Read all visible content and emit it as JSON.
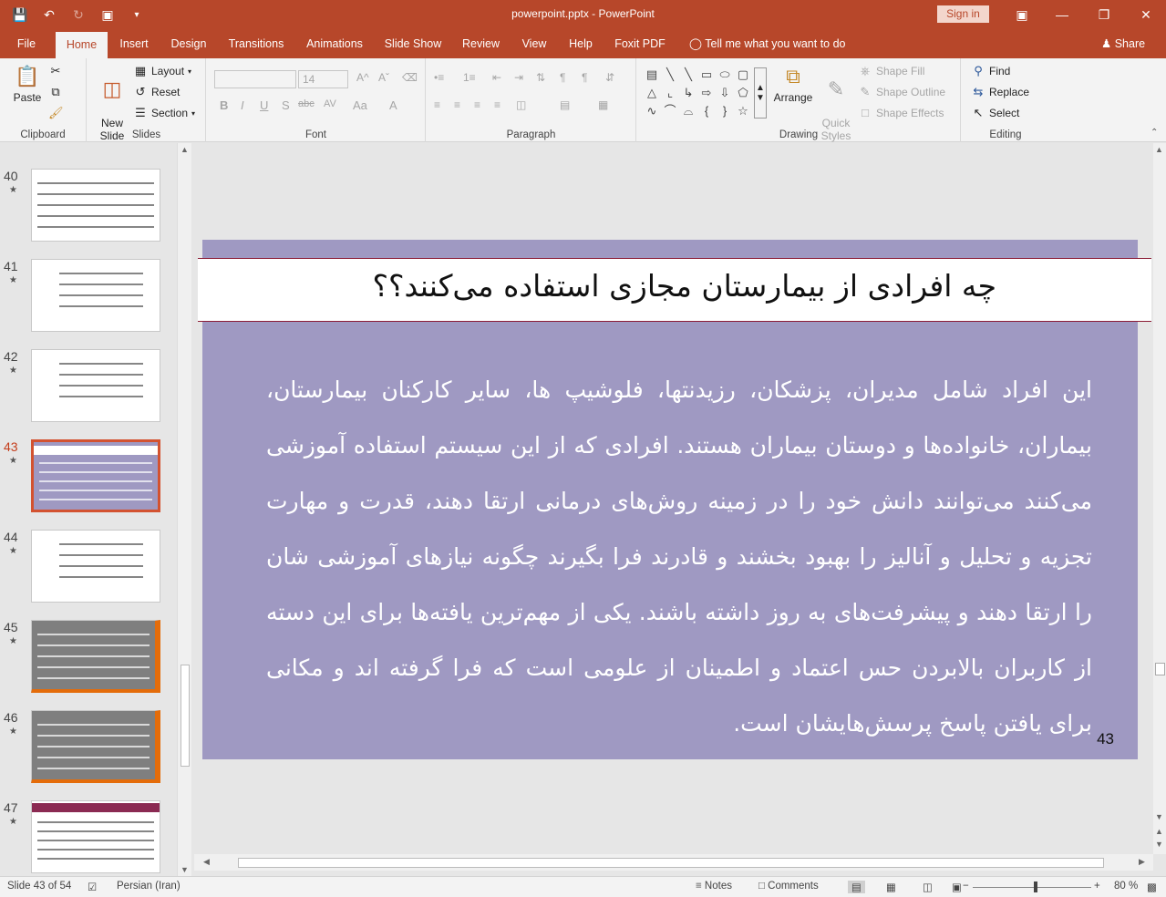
{
  "window": {
    "title": "powerpoint.pptx  -  PowerPoint",
    "signin": "Sign in"
  },
  "tabs": [
    "File",
    "Home",
    "Insert",
    "Design",
    "Transitions",
    "Animations",
    "Slide Show",
    "Review",
    "View",
    "Help",
    "Foxit PDF"
  ],
  "active_tab": "Home",
  "tell_me": "Tell me what you want to do",
  "share": "Share",
  "ribbon": {
    "clipboard": {
      "label": "Clipboard",
      "paste": "Paste"
    },
    "slides": {
      "label": "Slides",
      "new_slide": "New\nSlide",
      "layout": "Layout",
      "reset": "Reset",
      "section": "Section"
    },
    "font": {
      "label": "Font",
      "size": "14",
      "bold": "B",
      "italic": "I",
      "underline": "U",
      "shadow": "S",
      "strike": "abc",
      "spacing": "AV",
      "case": "Aa",
      "color": "A"
    },
    "paragraph": {
      "label": "Paragraph"
    },
    "drawing": {
      "label": "Drawing",
      "arrange": "Arrange",
      "quick_styles": "Quick\nStyles",
      "shape_fill": "Shape Fill",
      "shape_outline": "Shape Outline",
      "shape_effects": "Shape Effects"
    },
    "editing": {
      "label": "Editing",
      "find": "Find",
      "replace": "Replace",
      "select": "Select"
    }
  },
  "thumbnails": [
    {
      "num": "40",
      "type": "text-white"
    },
    {
      "num": "41",
      "type": "list-white"
    },
    {
      "num": "42",
      "type": "list-white"
    },
    {
      "num": "43",
      "type": "purple",
      "selected": true
    },
    {
      "num": "44",
      "type": "grid-white"
    },
    {
      "num": "45",
      "type": "gray-orange"
    },
    {
      "num": "46",
      "type": "gray-orange"
    },
    {
      "num": "47",
      "type": "header-white"
    }
  ],
  "slide": {
    "title": "چه افرادی از بیمارستان مجازی استفاده می‌کنند؟؟",
    "body": "این افراد شامل مدیران، پزشکان، رزیدنتها، فلوشیپ ها، سایر کارکنان بیمارستان، بیماران، خانواده‌ها و دوستان بیماران هستند. افرادی که از این سیستم استفاده آموزشی می‌کنند می‌توانند دانش خود را در زمینه روش‌های درمانی ارتقا دهند، قدرت و مهارت تجزیه و تحلیل و آنالیز را بهبود بخشند و قادرند فرا بگیرند چگونه نیازهای آموزشی شان را ارتقا دهند و پیشرفت‌های به روز داشته باشند. یکی از مهم‌ترین یافته‌ها برای این دسته از کاربران بالابردن حس اعتماد و اطمینان از علومی است که فرا گرفته اند و مکانی برای یافتن پاسخ پرسش‌هایشان است.",
    "number": "43",
    "bg_color": "#9f99c2"
  },
  "status": {
    "slide_info": "Slide 43 of 54",
    "language": "Persian (Iran)",
    "notes": "Notes",
    "comments": "Comments",
    "zoom": "80 %"
  },
  "colors": {
    "accent": "#b7472a",
    "selected": "#d35230"
  }
}
